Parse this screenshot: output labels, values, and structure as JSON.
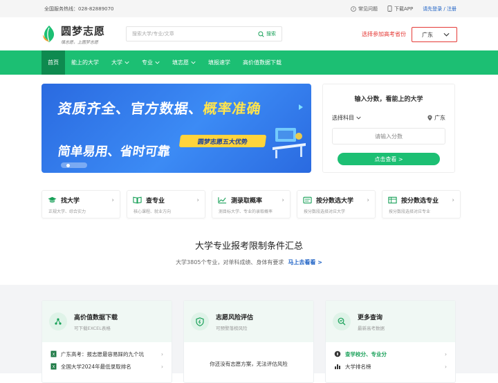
{
  "topbar": {
    "hotline": "全国服务热线：028-82889070",
    "faq": "常见问题",
    "app": "下载APP",
    "login": "请先登录 / 注册"
  },
  "header": {
    "brand": "圆梦志愿",
    "slogan": "填志愿，上圆梦志愿",
    "search_placeholder": "搜索大学/专业/文章",
    "search_button": "搜索",
    "choose_province": "选择参加高考省份",
    "province": "广东"
  },
  "nav": {
    "items": [
      {
        "label": "首页",
        "active": true
      },
      {
        "label": "能上的大学"
      },
      {
        "label": "大学"
      },
      {
        "label": "专业"
      },
      {
        "label": "填志愿"
      },
      {
        "label": "填报速学"
      },
      {
        "label": "高价值数据下载"
      }
    ]
  },
  "banner": {
    "line1a": "资质齐全、官方数据、",
    "line1b": "概率准确",
    "line2": "简单易用、省时可靠",
    "tag": "圆梦志愿五大优势"
  },
  "score": {
    "title": "输入分数，看能上的大学",
    "subject": "选择科目",
    "province": "广东",
    "placeholder": "请输入分数",
    "button": "点击查看 >"
  },
  "features": [
    {
      "title": "找大学",
      "desc": "正规大学、综合实力",
      "icon": "cap-icon"
    },
    {
      "title": "查专业",
      "desc": "核心课程、就业方向",
      "icon": "book-icon"
    },
    {
      "title": "测录取概率",
      "desc": "测目标大学、专业的录取概率",
      "icon": "chart-icon"
    },
    {
      "title": "按分数选大学",
      "desc": "按分数段选择对应大学",
      "icon": "list-icon"
    },
    {
      "title": "按分数选专业",
      "desc": "按分数段选择对应专业",
      "icon": "table-icon"
    }
  ],
  "limits": {
    "title": "大学专业报考限制条件汇总",
    "desc": "大学3805个专业，对单科成绩、身体有要求",
    "link": "马上去看看 >"
  },
  "panels": {
    "data": {
      "title": "高价值数据下载",
      "subtitle": "可下载EXCEL表格",
      "item1": "广东高考：报志愿最容易踩的九个坑",
      "item2": "全国大学2024年最低录取排名"
    },
    "risk": {
      "title": "志愿风险评估",
      "subtitle": "可预警落榜风险",
      "empty": "你还没有志愿方案，无法评估风险"
    },
    "more": {
      "title": "更多查询",
      "subtitle": "最新高考数据",
      "item1": "查学校分、专业分",
      "item2": "大学排名榜"
    }
  },
  "colors": {
    "accent": "#1cbf73",
    "nav_active": "#0e8a4f",
    "warning": "#e53935",
    "link": "#1a5fc4"
  }
}
